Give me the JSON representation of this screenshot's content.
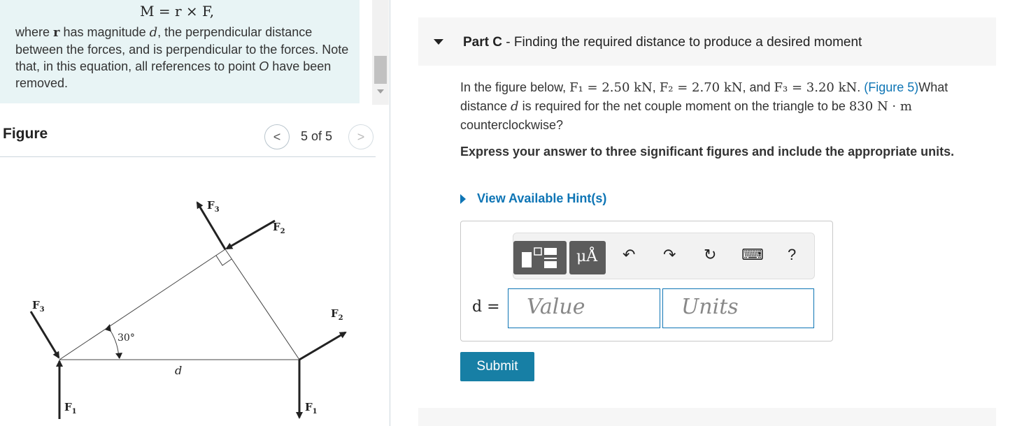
{
  "left_panel": {
    "formula": "M = r × F,",
    "text_parts": {
      "p1": "where ",
      "r": "r",
      "p2": " has magnitude ",
      "d": "d",
      "p3": ", the perpendicular distance between the forces, and is perpendicular to the forces. Note that, in this equation, all references to point ",
      "o": "O",
      "p4": " have been removed."
    }
  },
  "figure": {
    "title": "Figure",
    "prev": "<",
    "counter": "5 of 5",
    "next": ">",
    "labels": {
      "f3_top": "F",
      "f3_top_sub": "3",
      "f2_top": "F",
      "f2_top_sub": "2",
      "f3_left": "F",
      "f3_left_sub": "3",
      "f2_right": "F",
      "f2_right_sub": "2",
      "f1_left": "F",
      "f1_left_sub": "1",
      "f1_right": "F",
      "f1_right_sub": "1",
      "angle": "30°",
      "d": "d"
    }
  },
  "part": {
    "label": "Part C",
    "separator": " - ",
    "title": "Finding the required distance to produce a desired moment"
  },
  "problem": {
    "p1": "In the figure below, ",
    "f1": "F₁ = 2.50 kN",
    "c1": ", ",
    "f2": "F₂ = 2.70 kN",
    "c2": ", and ",
    "f3": "F₃ = 3.20 kN",
    "c3": ". ",
    "figure_link": "(Figure 5)",
    "p2": "What distance ",
    "d": "d",
    "p3": " is required for the net couple moment on the triangle to be ",
    "moment": "830 N · m",
    "p4": " counterclockwise?"
  },
  "instruction": "Express your answer to three significant figures and include the appropriate units.",
  "hints_label": "View Available Hint(s)",
  "answer": {
    "variable": "d =",
    "value_placeholder": "Value",
    "units_placeholder": "Units",
    "toolbar": {
      "templates_icon": "templates-icon",
      "units_label": "μÅ",
      "undo": "↶",
      "redo": "↷",
      "reset": "↻",
      "keyboard": "⌨",
      "help": "?"
    }
  },
  "submit_label": "Submit"
}
